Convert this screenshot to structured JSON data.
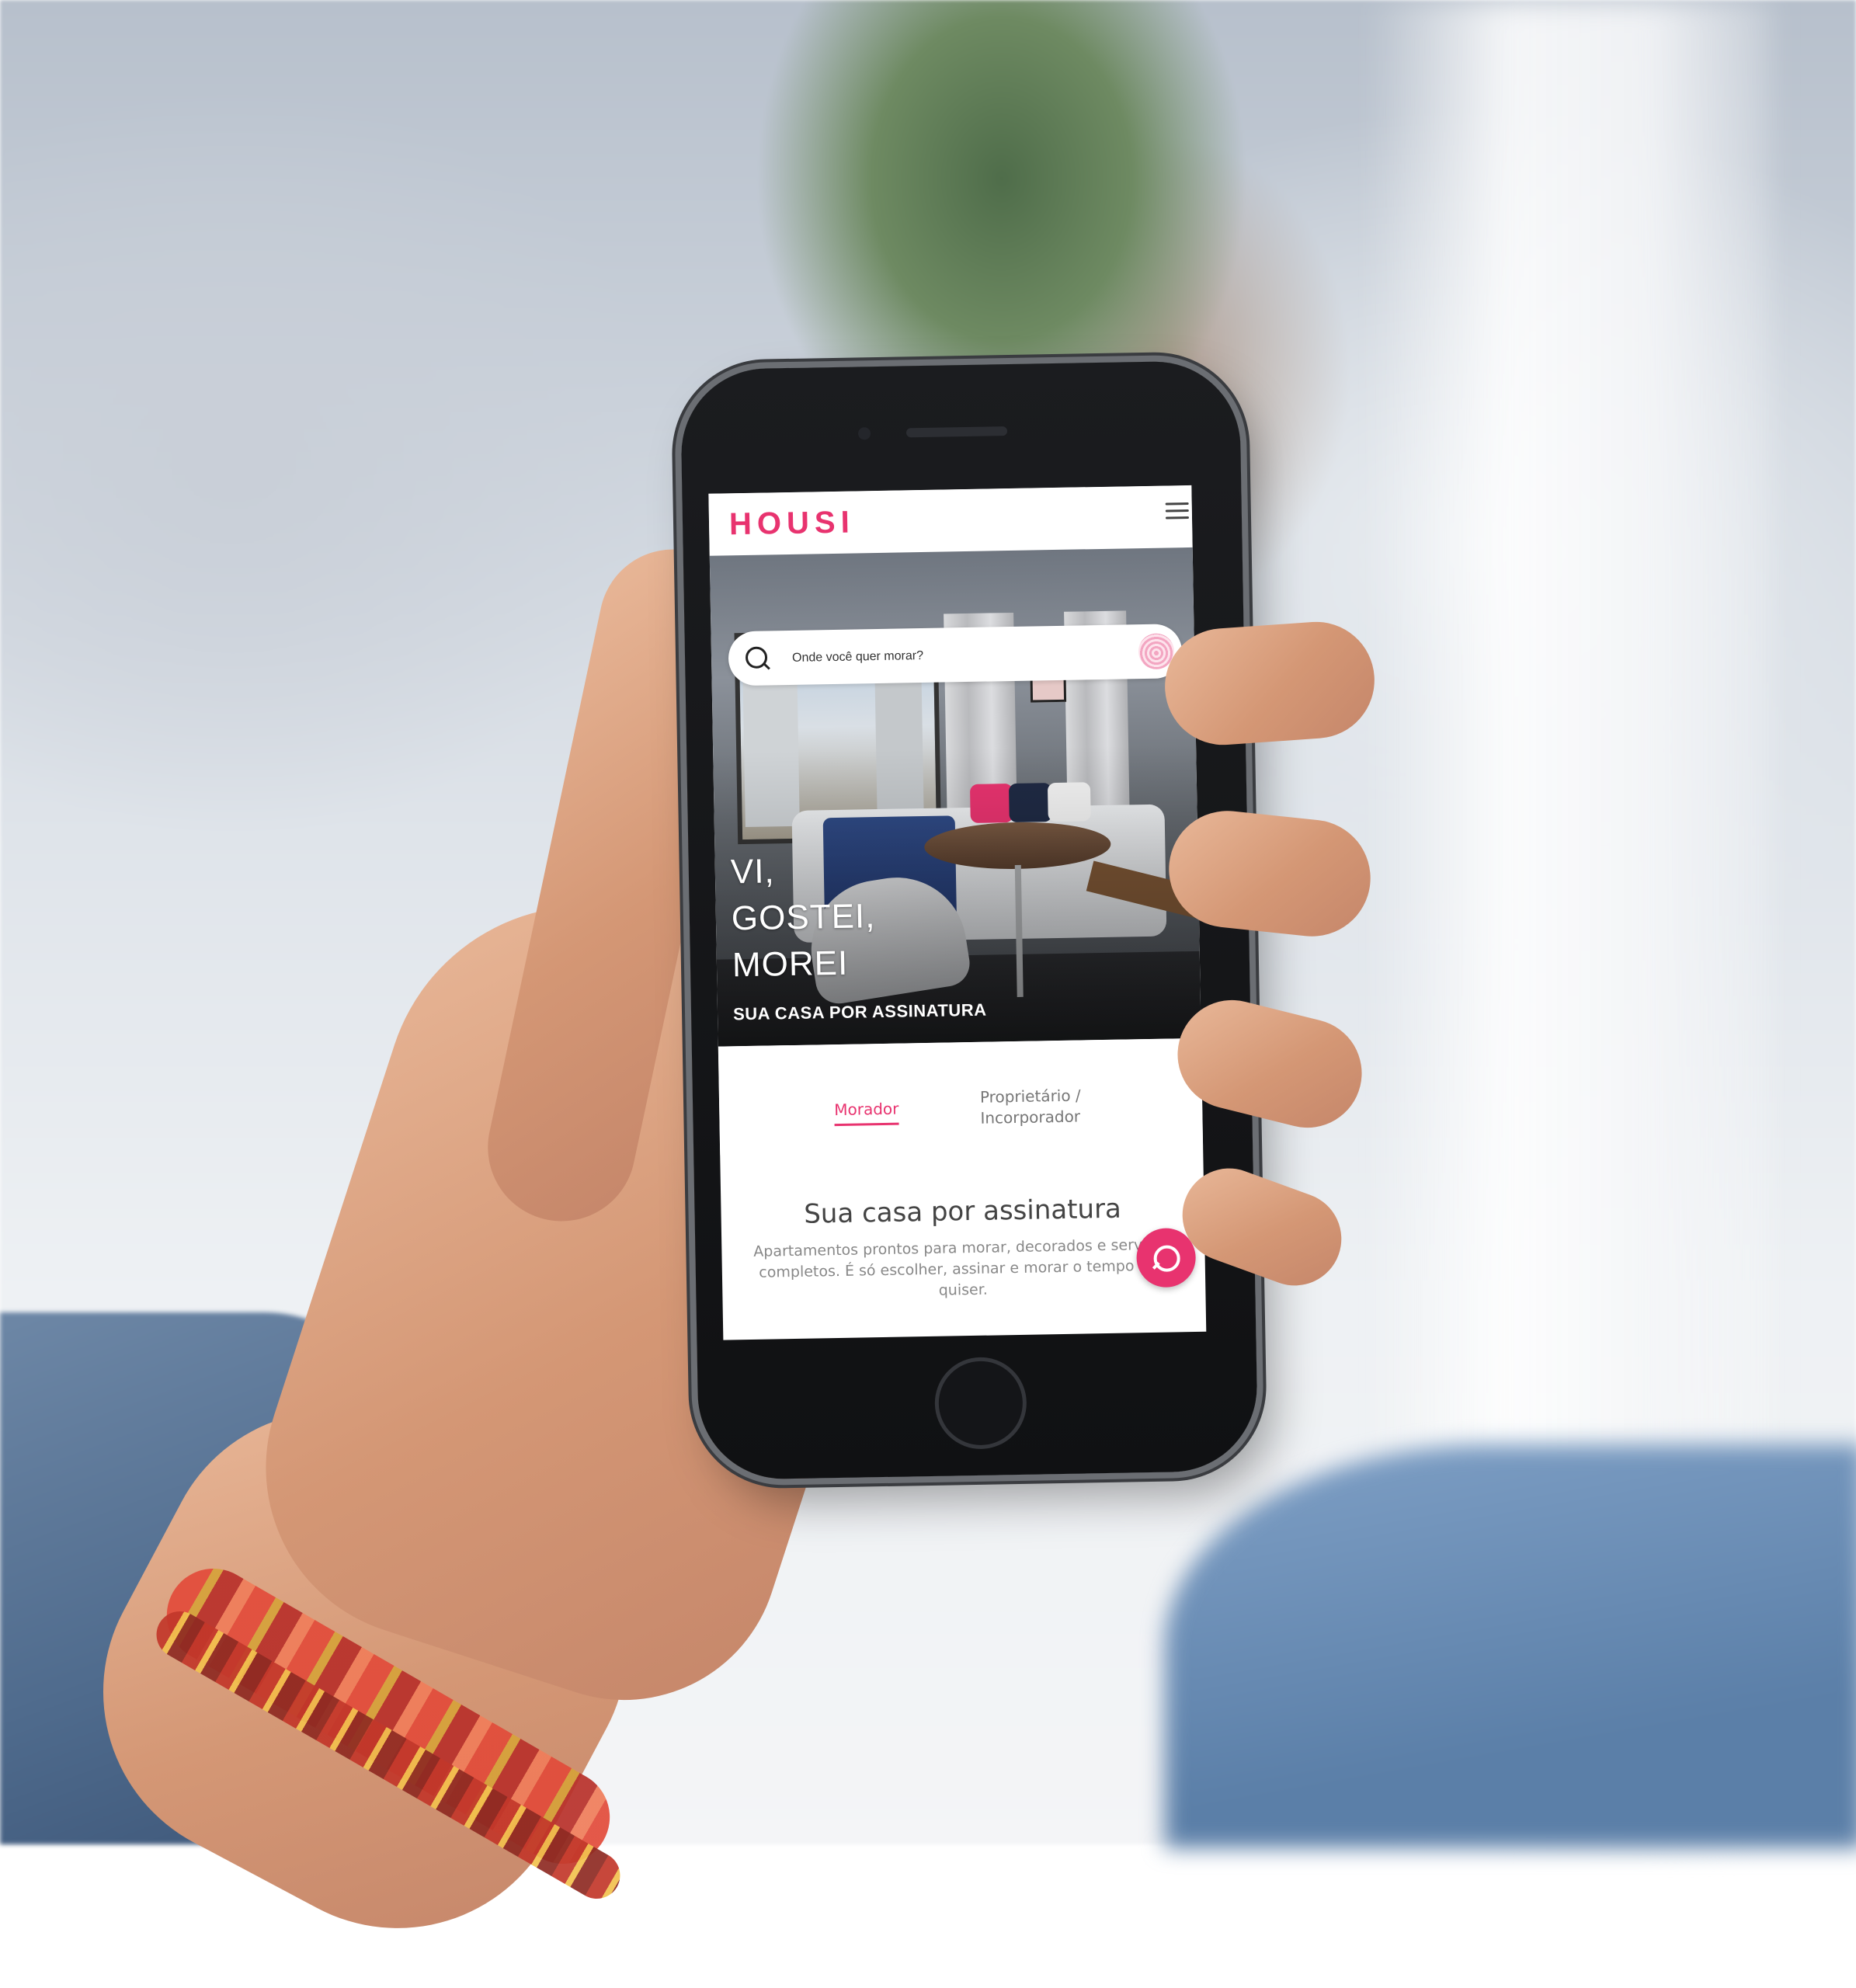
{
  "app": {
    "logo_text": "HOUSI",
    "brand_color": "#e8336f"
  },
  "search": {
    "placeholder": "Onde você quer morar?",
    "value": ""
  },
  "hero": {
    "headline_line1": "VI,",
    "headline_line2": "GOSTEI,",
    "headline_line3": "MOREI",
    "subtitle": "SUA CASA POR ASSINATURA"
  },
  "tabs": [
    {
      "label": "Morador",
      "active": true
    },
    {
      "label": "Proprietário / Incorporador",
      "active": false
    }
  ],
  "section": {
    "title": "Sua casa por assinatura",
    "description": "Apartamentos prontos para morar, decorados e serviços completos. É só escolher, assinar e morar o tempo que quiser."
  },
  "icons": {
    "menu": "hamburger-menu-icon",
    "search": "search-icon",
    "fingerprint": "fingerprint-icon",
    "chat": "chat-icon"
  }
}
